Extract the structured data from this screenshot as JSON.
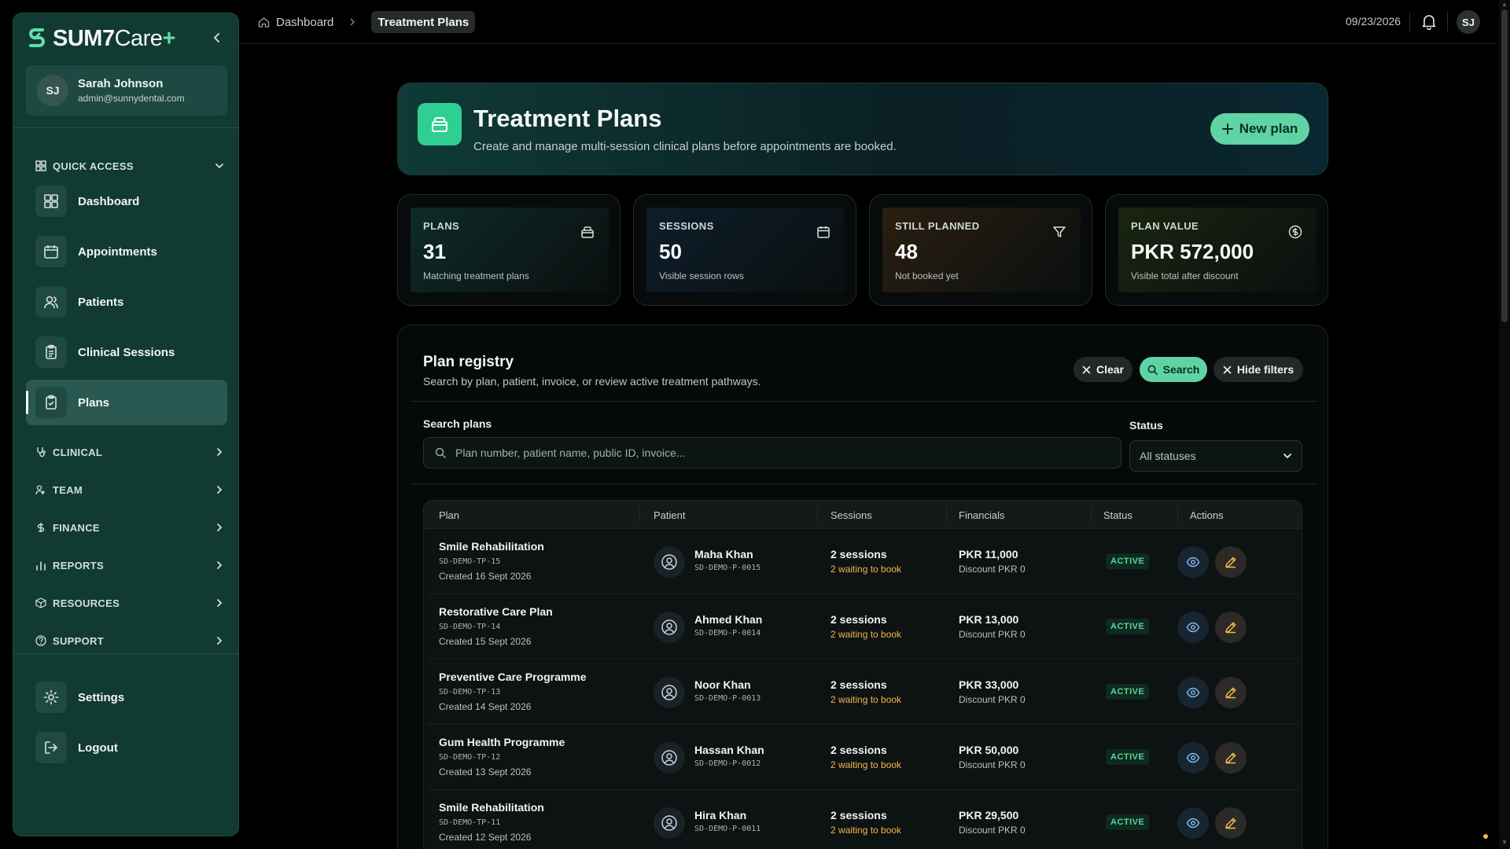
{
  "brand": {
    "name_bold": "SUM7",
    "name_light": "Care",
    "plus": "+"
  },
  "user": {
    "initials": "SJ",
    "name": "Sarah Johnson",
    "email": "admin@sunnydental.com"
  },
  "sidebar": {
    "quick_access": "QUICK ACCESS",
    "nav": [
      {
        "label": "Dashboard",
        "icon": "grid-icon"
      },
      {
        "label": "Appointments",
        "icon": "calendar-icon"
      },
      {
        "label": "Patients",
        "icon": "users-icon"
      },
      {
        "label": "Clinical Sessions",
        "icon": "clipboard-icon"
      },
      {
        "label": "Plans",
        "icon": "clipboard-check-icon"
      }
    ],
    "sections": [
      {
        "label": "CLINICAL",
        "icon": "stethoscope-icon"
      },
      {
        "label": "TEAM",
        "icon": "user-group-icon"
      },
      {
        "label": "FINANCE",
        "icon": "dollar-icon"
      },
      {
        "label": "REPORTS",
        "icon": "bar-chart-icon"
      },
      {
        "label": "RESOURCES",
        "icon": "box-icon"
      },
      {
        "label": "SUPPORT",
        "icon": "help-circle-icon"
      }
    ],
    "settings": "Settings",
    "logout": "Logout"
  },
  "topbar": {
    "breadcrumb_home": "Dashboard",
    "breadcrumb_current": "Treatment Plans",
    "date": "09/23/2026",
    "avatar": "SJ"
  },
  "hero": {
    "title": "Treatment Plans",
    "subtitle": "Create and manage multi-session clinical plans before appointments are booked.",
    "new_plan": "New plan"
  },
  "stats": [
    {
      "label": "PLANS",
      "value": "31",
      "note": "Matching treatment plans",
      "icon": "archive-icon",
      "bg": "#0e2b27"
    },
    {
      "label": "SESSIONS",
      "value": "50",
      "note": "Visible session rows",
      "icon": "calendar-icon",
      "bg": "#0e1d2b"
    },
    {
      "label": "STILL PLANNED",
      "value": "48",
      "note": "Not booked yet",
      "icon": "filter-icon",
      "bg": "#2a1e10"
    },
    {
      "label": "PLAN VALUE",
      "value": "PKR 572,000",
      "note": "Visible total after discount",
      "icon": "dollar-circle-icon",
      "bg": "#1a2510"
    }
  ],
  "registry": {
    "title": "Plan registry",
    "subtitle": "Search by plan, patient, invoice, or review active treatment pathways.",
    "clear": "Clear",
    "search": "Search",
    "hide_filters": "Hide filters",
    "search_label": "Search plans",
    "search_placeholder": "Plan number, patient name, public ID, invoice...",
    "status_label": "Status",
    "status_value": "All statuses",
    "columns": [
      "Plan",
      "Patient",
      "Sessions",
      "Financials",
      "Status",
      "Actions"
    ],
    "rows": [
      {
        "plan": "Smile Rehabilitation",
        "code": "SD-DEMO-TP-15",
        "created": "Created 16 Sept 2026",
        "patient": "Maha Khan",
        "pid": "SD-DEMO-P-0015",
        "sessions": "2 sessions",
        "waiting": "2 waiting to book",
        "amount": "PKR 11,000",
        "discount": "Discount PKR 0",
        "status": "ACTIVE"
      },
      {
        "plan": "Restorative Care Plan",
        "code": "SD-DEMO-TP-14",
        "created": "Created 15 Sept 2026",
        "patient": "Ahmed Khan",
        "pid": "SD-DEMO-P-0014",
        "sessions": "2 sessions",
        "waiting": "2 waiting to book",
        "amount": "PKR 13,000",
        "discount": "Discount PKR 0",
        "status": "ACTIVE"
      },
      {
        "plan": "Preventive Care Programme",
        "code": "SD-DEMO-TP-13",
        "created": "Created 14 Sept 2026",
        "patient": "Noor Khan",
        "pid": "SD-DEMO-P-0013",
        "sessions": "2 sessions",
        "waiting": "2 waiting to book",
        "amount": "PKR 33,000",
        "discount": "Discount PKR 0",
        "status": "ACTIVE"
      },
      {
        "plan": "Gum Health Programme",
        "code": "SD-DEMO-TP-12",
        "created": "Created 13 Sept 2026",
        "patient": "Hassan Khan",
        "pid": "SD-DEMO-P-0012",
        "sessions": "2 sessions",
        "waiting": "2 waiting to book",
        "amount": "PKR 50,000",
        "discount": "Discount PKR 0",
        "status": "ACTIVE"
      },
      {
        "plan": "Smile Rehabilitation",
        "code": "SD-DEMO-TP-11",
        "created": "Created 12 Sept 2026",
        "patient": "Hira Khan",
        "pid": "SD-DEMO-P-0011",
        "sessions": "2 sessions",
        "waiting": "2 waiting to book",
        "amount": "PKR 29,500",
        "discount": "Discount PKR 0",
        "status": "ACTIVE"
      }
    ]
  },
  "colors": {
    "accent": "#5fd3a4",
    "sidebar": "#113a33",
    "warning": "#f3b84a",
    "active_badge": "#58d69b"
  }
}
